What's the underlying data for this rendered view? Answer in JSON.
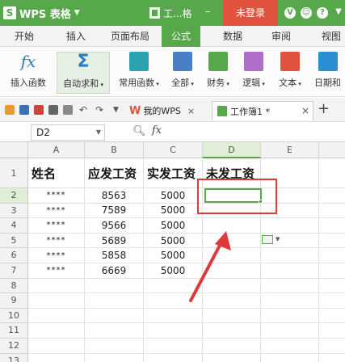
{
  "app": {
    "logo_letter": "S",
    "name": "WPS 表格",
    "doc_title": "工...格",
    "login": "未登录"
  },
  "menu": [
    "开始",
    "插入",
    "页面布局",
    "公式",
    "数据",
    "审阅",
    "视图"
  ],
  "active_menu_index": 3,
  "ribbon": [
    "插入函数",
    "自动求和",
    "常用函数",
    "全部",
    "财务",
    "逻辑",
    "文本",
    "日期和"
  ],
  "ribbon_colors": [
    "#2a7bc0",
    "#2a7bc0",
    "#2aa3b0",
    "#4a7fc6",
    "#57a84a",
    "#b06fc6",
    "#e2533d",
    "#2a8fd1"
  ],
  "tabs": {
    "wps": "我的WPS",
    "book": "工作簿1 *"
  },
  "formula_bar": {
    "cell_ref": "D2",
    "fx": "fx"
  },
  "columns": [
    "A",
    "B",
    "C",
    "D",
    "E"
  ],
  "selected_column": "D",
  "rows": [
    "1",
    "2",
    "3",
    "4",
    "5",
    "6",
    "7",
    "8",
    "9",
    "10",
    "11",
    "12",
    "13"
  ],
  "selected_row": "2",
  "sheet": {
    "headers": [
      "姓名",
      "应发工资",
      "实发工资",
      "未发工资"
    ],
    "data": [
      [
        "****",
        "8563",
        "5000",
        ""
      ],
      [
        "****",
        "7589",
        "5000",
        ""
      ],
      [
        "****",
        "9566",
        "5000",
        ""
      ],
      [
        "****",
        "5689",
        "5000",
        ""
      ],
      [
        "****",
        "5858",
        "5000",
        ""
      ],
      [
        "****",
        "6669",
        "5000",
        ""
      ]
    ]
  },
  "colors": {
    "brand": "#57a84a",
    "login": "#e2533d",
    "annotation": "#e0393a"
  }
}
